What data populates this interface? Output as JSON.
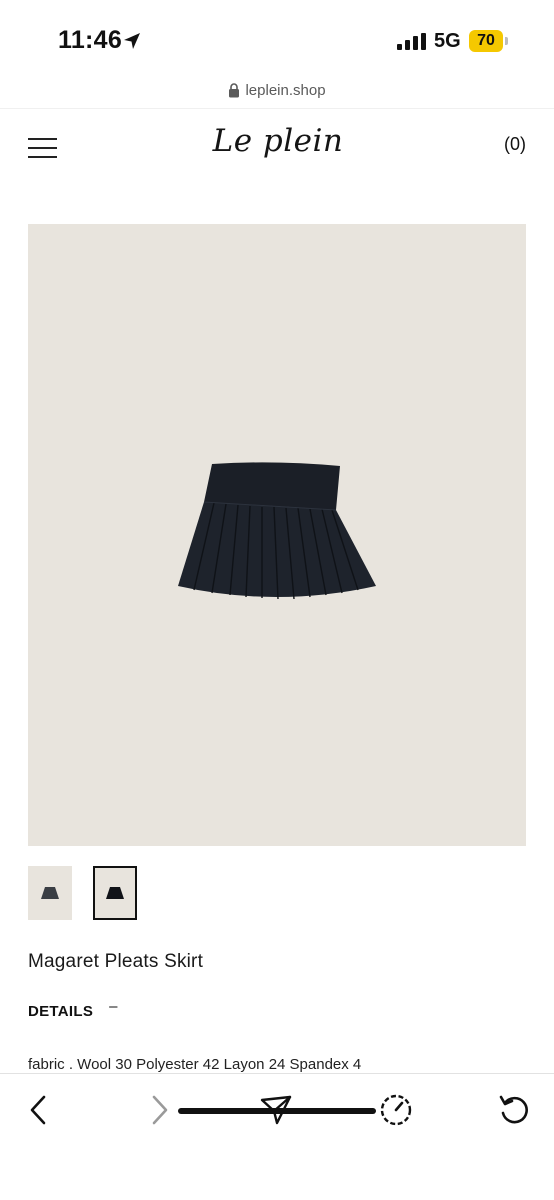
{
  "status_bar": {
    "time": "11:46",
    "network": "5G",
    "battery": "70"
  },
  "browser": {
    "url": "leplein.shop"
  },
  "site": {
    "logo": "Le plein",
    "cart_count": "(0)"
  },
  "product": {
    "name": "Magaret Pleats Skirt",
    "details_label": "DETAILS",
    "details_toggle_icon": "–",
    "fabric": "fabric . Wool 30 Polyester 42 Layon 24 Spandex 4",
    "image_background": "#e8e4dd",
    "skirt_color": "#1b1f27"
  },
  "icons": {
    "location": "location-arrow-icon",
    "signal": "signal-bars-icon",
    "lock": "lock-icon",
    "menu": "hamburger-menu-icon",
    "back": "chevron-left-icon",
    "forward": "chevron-right-icon",
    "share": "paper-plane-icon",
    "speed": "speedometer-icon",
    "reload": "reload-icon"
  }
}
